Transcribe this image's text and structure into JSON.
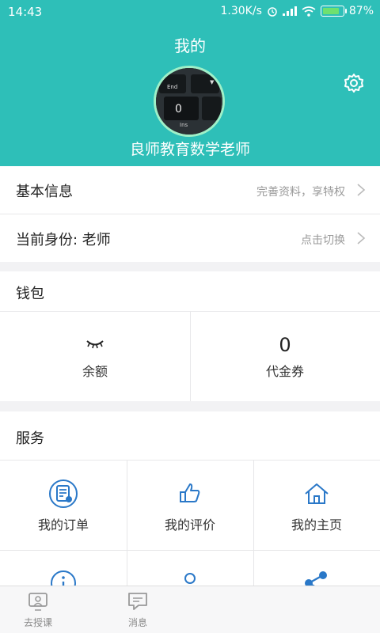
{
  "status_bar": {
    "time": "14:43",
    "speed": "1.30K/s",
    "battery": "87%",
    "battery_level": 0.87
  },
  "header": {
    "title": "我的",
    "username": "良师教育数学老师"
  },
  "rows": {
    "basic_info": {
      "label": "基本信息",
      "hint": "完善资料，享特权"
    },
    "identity": {
      "label": "当前身份: 老师",
      "hint": "点击切换"
    }
  },
  "wallet": {
    "title": "钱包",
    "balance_label": "余额",
    "voucher_value": "0",
    "voucher_label": "代金券"
  },
  "services": {
    "title": "服务",
    "items": [
      {
        "label": "我的订单",
        "icon": "order-icon"
      },
      {
        "label": "我的评价",
        "icon": "thumb-up-icon"
      },
      {
        "label": "我的主页",
        "icon": "home-icon"
      },
      {
        "label": "",
        "icon": "info-icon"
      },
      {
        "label": "",
        "icon": "person-icon"
      },
      {
        "label": "",
        "icon": "share-icon"
      }
    ]
  },
  "bottom_nav": [
    {
      "label": "去授课",
      "icon": "teach-icon"
    },
    {
      "label": "消息",
      "icon": "message-icon"
    }
  ],
  "colors": {
    "primary": "#2ebfb8",
    "icon_blue": "#2a78c8"
  }
}
